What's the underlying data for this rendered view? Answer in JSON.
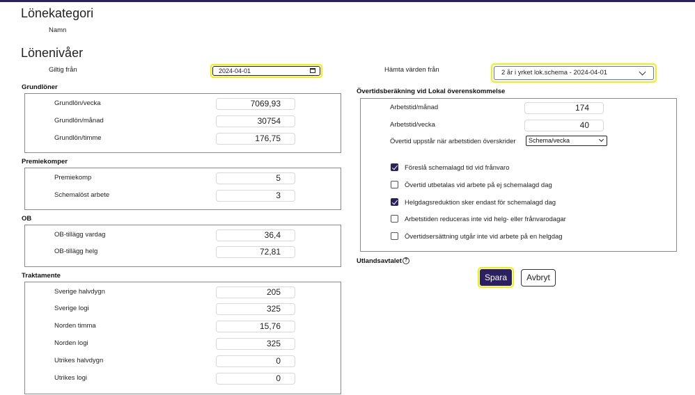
{
  "page": {
    "title1": "Lönekategori",
    "name_label": "Namn",
    "title2": "Lönenivåer",
    "valid_from_label": "Giltig från",
    "valid_from_value": "2024-04-01",
    "fetch_label": "Hämta värden från",
    "fetch_value": "2 år i yrket lok.schema - 2024-04-01"
  },
  "groups": {
    "grundloner": {
      "title": "Grundlöner",
      "rows": [
        {
          "label": "Grundlön/vecka",
          "value": "7069,93"
        },
        {
          "label": "Grundlön/månad",
          "value": "30754"
        },
        {
          "label": "Grundlön/timme",
          "value": "176,75"
        }
      ]
    },
    "premiekomper": {
      "title": "Premiekomper",
      "rows": [
        {
          "label": "Premiekomp",
          "value": "5"
        },
        {
          "label": "Schemalöst arbete",
          "value": "3"
        }
      ]
    },
    "ob": {
      "title": "OB",
      "rows": [
        {
          "label": "OB-tillägg vardag",
          "value": "36,4"
        },
        {
          "label": "OB-tillägg helg",
          "value": "72,81"
        }
      ]
    },
    "traktamente": {
      "title": "Traktamente",
      "rows": [
        {
          "label": "Sverige halvdygn",
          "value": "205"
        },
        {
          "label": "Sverige logi",
          "value": "325"
        },
        {
          "label": "Norden timma",
          "value": "15,76"
        },
        {
          "label": "Norden logi",
          "value": "325"
        },
        {
          "label": "Utrikes halvdygn",
          "value": "0"
        },
        {
          "label": "Utrikes logi",
          "value": "0"
        }
      ]
    }
  },
  "overtid": {
    "title": "Övertidsberäkning vid Lokal överenskommelse",
    "arbetstid_manad_label": "Arbetstid/månad",
    "arbetstid_manad_value": "174",
    "arbetstid_vecka_label": "Arbetstid/vecka",
    "arbetstid_vecka_value": "40",
    "overskrider_label": "Övertid uppstår när arbetstiden överskrider",
    "overskrider_value": "Schema/vecka",
    "checkboxes": [
      {
        "label": "Föreslå schemalagd tid vid frånvaro",
        "checked": true
      },
      {
        "label": "Övertid utbetalas vid arbete på ej schemalagd dag",
        "checked": false
      },
      {
        "label": "Helgdagsreduktion sker endast för schemalagd dag",
        "checked": true
      },
      {
        "label": "Arbetstiden reduceras inte vid helg- eller frånvarodagar",
        "checked": false
      },
      {
        "label": "Övertidsersättning utgår inte vid arbete på en helgdag",
        "checked": false
      }
    ]
  },
  "utland": {
    "label": "Utlandsavtalet",
    "help_icon": "question-circle-icon"
  },
  "buttons": {
    "save": "Spara",
    "cancel": "Avbryt"
  },
  "colors": {
    "primary": "#2b2160",
    "focus_highlight": "#f3f000",
    "select_border": "#4c7bd1"
  }
}
